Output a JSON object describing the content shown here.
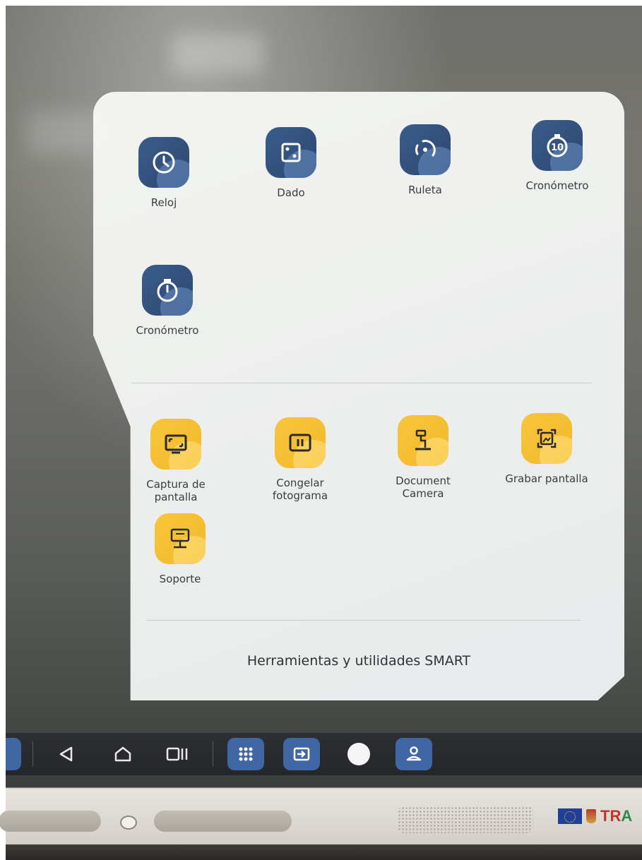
{
  "smart_tools": {
    "footer_title": "Herramientas y utilidades SMART",
    "widgets": [
      {
        "label": "Reloj",
        "icon": "clock-icon"
      },
      {
        "label": "Dado",
        "icon": "dice-icon"
      },
      {
        "label": "Ruleta",
        "icon": "spinner-wheel-icon"
      },
      {
        "label": "Cronómetro",
        "icon": "timer-10-icon"
      },
      {
        "label": "Cronómetro",
        "icon": "stopwatch-icon"
      }
    ],
    "utilities": [
      {
        "label_line1": "Captura de",
        "label_line2": "pantalla",
        "icon": "screen-capture-icon"
      },
      {
        "label_line1": "Congelar",
        "label_line2": "fotograma",
        "icon": "freeze-frame-icon"
      },
      {
        "label_line1": "Document",
        "label_line2": "Camera",
        "icon": "document-camera-icon"
      },
      {
        "label_line1": "Grabar pantalla",
        "label_line2": "",
        "icon": "screen-record-icon"
      },
      {
        "label_line1": "Soporte",
        "label_line2": "",
        "icon": "support-icon"
      }
    ]
  },
  "navbar": {
    "items": [
      "back-icon",
      "home-icon",
      "recents-icon",
      "apps-grid-icon",
      "input-source-icon",
      "assistant-dot-icon",
      "user-icon"
    ]
  },
  "colors": {
    "widget_icon_bg": "#3b5d8c",
    "utility_icon_bg": "#f2b92a",
    "nav_pill": "#3f67a3"
  }
}
